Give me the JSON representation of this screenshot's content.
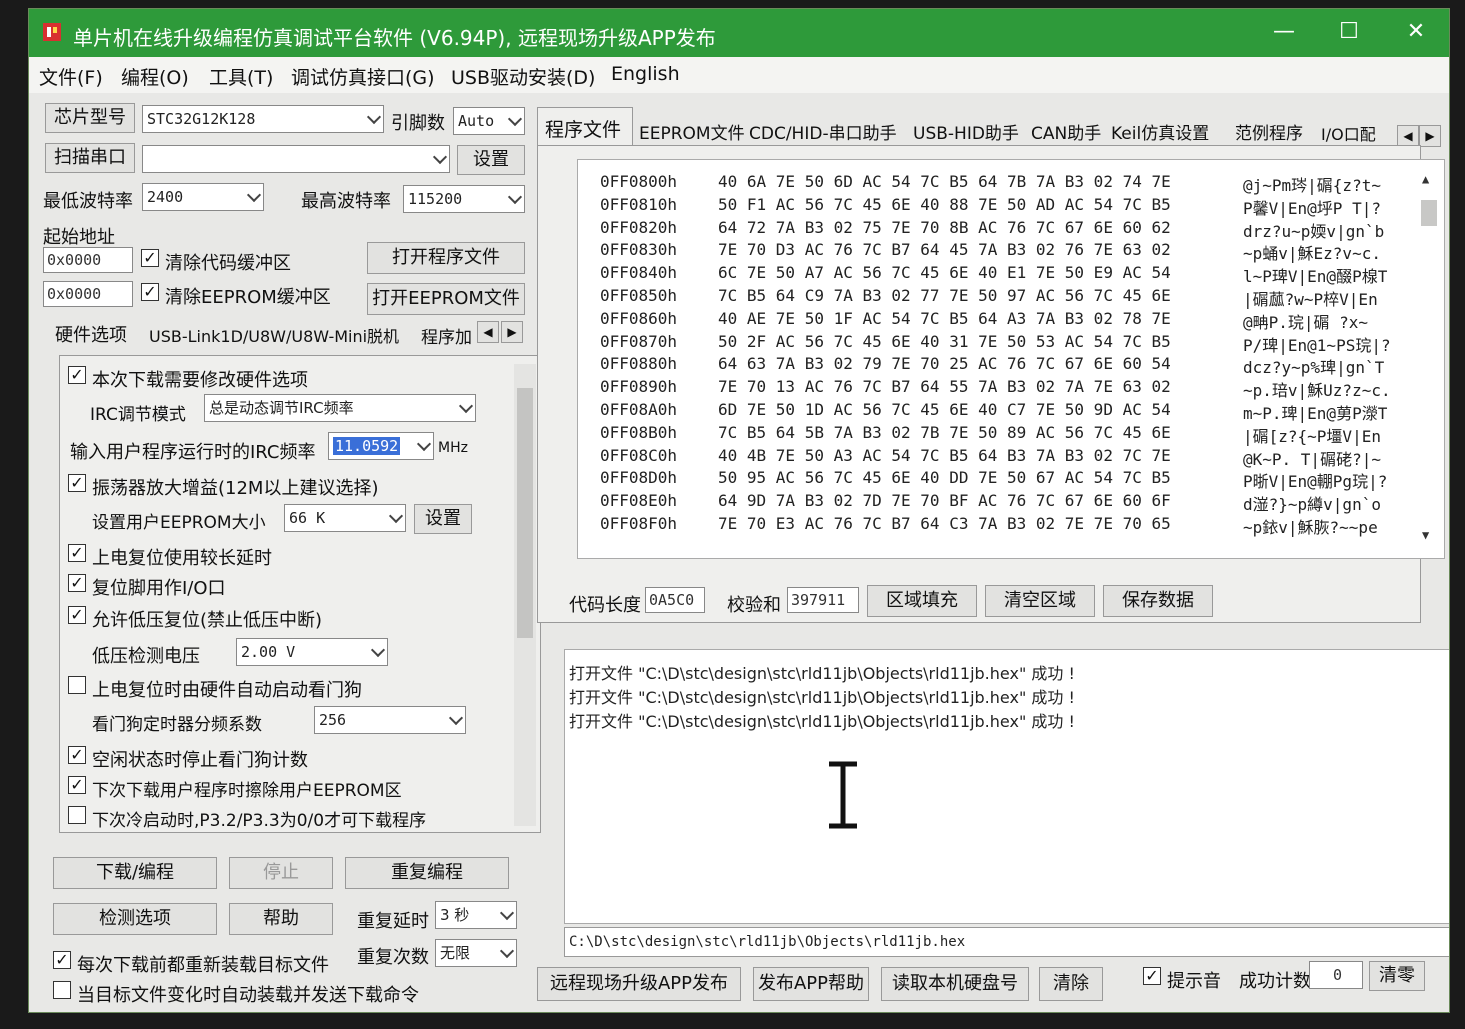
{
  "window": {
    "title": "单片机在线升级编程仿真调试平台软件 (V6.94P), 远程现场升级APP发布",
    "colors": {
      "titlebar": "#2e9a3a",
      "highlight": "#3a6fd8"
    }
  },
  "menu": [
    "文件(F)",
    "编程(O)",
    "工具(T)",
    "调试仿真接口(G)",
    "USB驱动安装(D)",
    "English"
  ],
  "left": {
    "chip_model_label": "芯片型号",
    "chip_model": "STC32G12K128",
    "pins_label": "引脚数",
    "pins": "Auto",
    "scan_port_label": "扫描串口",
    "port_value": "",
    "settings_label": "设置",
    "min_baud_label": "最低波特率",
    "min_baud": "2400",
    "max_baud_label": "最高波特率",
    "max_baud": "115200",
    "start_addr_label": "起始地址",
    "addr1": "0x0000",
    "addr2": "0x0000",
    "clear_code_label": "清除代码缓冲区",
    "clear_eeprom_label": "清除EEPROM缓冲区",
    "open_program_label": "打开程序文件",
    "open_eeprom_label": "打开EEPROM文件",
    "tabs": [
      "硬件选项",
      "USB-Link1D/U8W/U8W-Mini脱机",
      "程序加"
    ]
  },
  "hw": {
    "modify_label": "本次下载需要修改硬件选项",
    "irc_mode_label": "IRC调节模式",
    "irc_mode": "总是动态调节IRC频率",
    "irc_freq_label": "输入用户程序运行时的IRC频率",
    "irc_freq": "11.0592",
    "mhz": "MHz",
    "osc_gain_label": "振荡器放大增益(12M以上建议选择)",
    "eeprom_size_label": "设置用户EEPROM大小",
    "eeprom_size": "66   K",
    "set_label": "设置",
    "long_delay_label": "上电复位使用较长延时",
    "reset_io_label": "复位脚用作I/O口",
    "lvr_label": "允许低压复位(禁止低压中断)",
    "lv_detect_label": "低压检测电压",
    "lv_detect": "2.00 V",
    "wdt_auto_label": "上电复位时由硬件自动启动看门狗",
    "wdt_div_label": "看门狗定时器分频系数",
    "wdt_div": "256",
    "idle_wdt_label": "空闲状态时停止看门狗计数",
    "erase_eeprom_label": "下次下载用户程序时擦除用户EEPROM区",
    "p32_label": "下次冷启动时,P3.2/P3.3为0/0才可下载程序"
  },
  "bottom_left": {
    "download_label": "下载/编程",
    "stop_label": "停止",
    "reprogram_label": "重复编程",
    "check_label": "检测选项",
    "help_label": "帮助",
    "repeat_delay_label": "重复延时",
    "repeat_delay": "3 秒",
    "repeat_count_label": "重复次数",
    "repeat_count": "无限",
    "reload_label": "每次下载前都重新装载目标文件",
    "autoload_label": "当目标文件变化时自动装载并发送下载命令"
  },
  "right_tabs": [
    "程序文件",
    "EEPROM文件",
    "CDC/HID-串口助手",
    "USB-HID助手",
    "CAN助手",
    "Keil仿真设置",
    "范例程序",
    "I/O口配"
  ],
  "hex_rows": [
    {
      "addr": "0FF0800h",
      "bytes": "40 6A 7E 50 6D AC 54 7C B5 64 7B 7A B3 02 74 7E",
      "ascii": "@j~Pm琌|碿{z?t~"
    },
    {
      "addr": "0FF0810h",
      "bytes": "50 F1 AC 56 7C 45 6E 40 88 7E 50 AD AC 54 7C B5",
      "ascii": "P馨V|En@垀P  T|?"
    },
    {
      "addr": "0FF0820h",
      "bytes": "64 72 7A B3 02 75 7E 70 8B AC 76 7C 67 6E 60 62",
      "ascii": "drz?u~p媆v|gn`b"
    },
    {
      "addr": "0FF0830h",
      "bytes": "7E 70 D3 AC 76 7C B7 64 45 7A B3 02 76 7E 63 02",
      "ascii": "~p蛹v|穌Ez?v~c."
    },
    {
      "addr": "0FF0840h",
      "bytes": "6C 7E 50 A7 AC 56 7C 45 6E 40 E1 7E 50 E9 AC 54",
      "ascii": "l~P琕V|En@醊P楾T"
    },
    {
      "addr": "0FF0850h",
      "bytes": "7C B5 64 C9 7A B3 02 77 7E 50 97 AC 56 7C 45 6E",
      "ascii": "|碿蓏?w~P椊V|En"
    },
    {
      "addr": "0FF0860h",
      "bytes": "40 AE 7E 50 1F AC 54 7C B5 64 A3 7A B3 02 78 7E",
      "ascii": "@畘P.琓|碿     ?x~"
    },
    {
      "addr": "0FF0870h",
      "bytes": "50 2F AC 56 7C 45 6E 40 31 7E 50 53 AC 54 7C B5",
      "ascii": "P/琕|En@1~PS琓|?"
    },
    {
      "addr": "0FF0880h",
      "bytes": "64 63 7A B3 02 79 7E 70 25 AC 76 7C 67 6E 60 54",
      "ascii": "dcz?y~p%琕|gn`T"
    },
    {
      "addr": "0FF0890h",
      "bytes": "7E 70 13 AC 76 7C B7 64 55 7A B3 02 7A 7E 63 02",
      "ascii": "~p.琣v|穌Uz?z~c."
    },
    {
      "addr": "0FF08A0h",
      "bytes": "6D 7E 50 1D AC 56 7C 45 6E 40 C7 7E 50 9D AC 54",
      "ascii": "m~P.琕|En@莮P濴T"
    },
    {
      "addr": "0FF08B0h",
      "bytes": "7C B5 64 5B 7A B3 02 7B 7E 50 89 AC 56 7C 45 6E",
      "ascii": "|碿[z?{~P壃V|En"
    },
    {
      "addr": "0FF08C0h",
      "bytes": "40 4B 7E 50 A3 AC 54 7C B5 64 B3 7A B3 02 7C 7E",
      "ascii": "@K~P. T|碿硓?|~"
    },
    {
      "addr": "0FF08D0h",
      "bytes": "50 95 AC 56 7C 45 6E 40 DD 7E 50 67 AC 54 7C B5",
      "ascii": "P晣V|En@輣Pg琓|?"
    },
    {
      "addr": "0FF08E0h",
      "bytes": "64 9D 7A B3 02 7D 7E 70 BF AC 76 7C 67 6E 60 6F",
      "ascii": "d潂?}~p繜v|gn`o"
    },
    {
      "addr": "0FF08F0h",
      "bytes": "7E 70 E3 AC 76 7C B7 64 C3 7A B3 02 7E 7E 70 65",
      "ascii": "~p銥v|穌脄?~~pe"
    }
  ],
  "hex_footer": {
    "code_len_label": "代码长度",
    "code_len": "0A5C0",
    "checksum_label": "校验和",
    "checksum": "397911",
    "fill_label": "区域填充",
    "clear_label": "清空区域",
    "save_label": "保存数据"
  },
  "log": [
    "打开文件 \"C:\\D\\stc\\design\\stc\\rld11jb\\Objects\\rld11jb.hex\" 成功 !",
    "打开文件 \"C:\\D\\stc\\design\\stc\\rld11jb\\Objects\\rld11jb.hex\" 成功 !",
    "打开文件 \"C:\\D\\stc\\design\\stc\\rld11jb\\Objects\\rld11jb.hex\" 成功 !"
  ],
  "path": "C:\\D\\stc\\design\\stc\\rld11jb\\Objects\\rld11jb.hex",
  "bottom_right": {
    "remote_label": "远程现场升级APP发布",
    "app_help_label": "发布APP帮助",
    "read_disk_label": "读取本机硬盘号",
    "clear_label": "清除",
    "sound_label": "提示音",
    "success_label": "成功计数",
    "success_count": "0",
    "reset_label": "清零"
  }
}
